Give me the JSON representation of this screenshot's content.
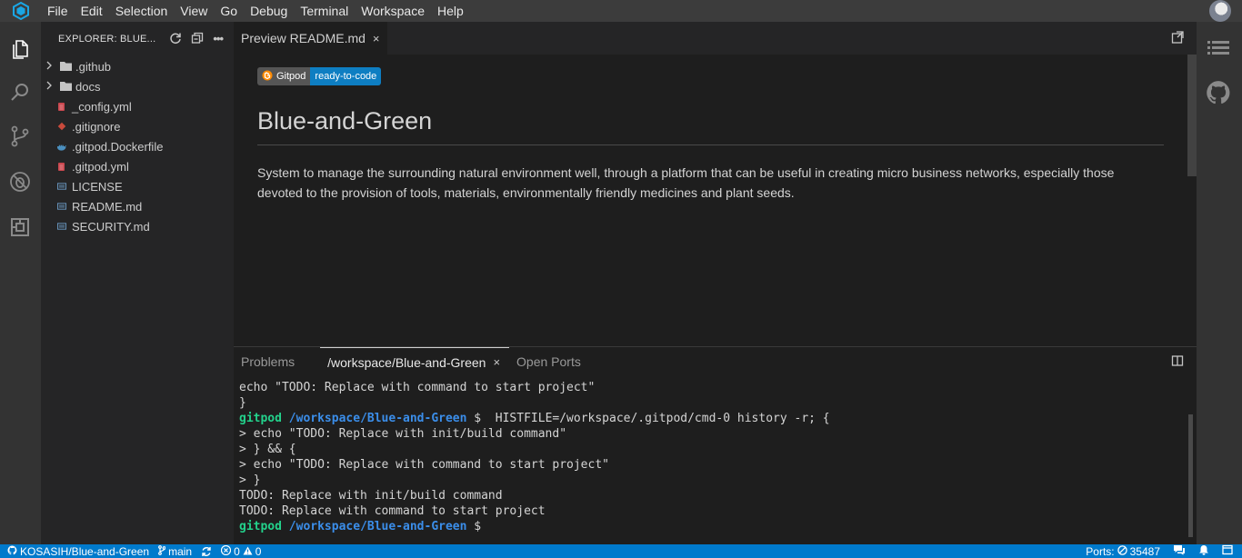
{
  "menu": {
    "items": [
      "File",
      "Edit",
      "Selection",
      "View",
      "Go",
      "Debug",
      "Terminal",
      "Workspace",
      "Help"
    ]
  },
  "activity_bar": {
    "icons": [
      "files-icon",
      "search-icon",
      "source-control-icon",
      "debug-icon",
      "extensions-icon"
    ]
  },
  "explorer": {
    "title": "EXPLORER: BLUE...",
    "items": [
      {
        "label": ".github",
        "type": "folder"
      },
      {
        "label": "docs",
        "type": "folder"
      },
      {
        "label": "_config.yml",
        "type": "yaml"
      },
      {
        "label": ".gitignore",
        "type": "git"
      },
      {
        "label": ".gitpod.Dockerfile",
        "type": "docker"
      },
      {
        "label": ".gitpod.yml",
        "type": "yaml"
      },
      {
        "label": "LICENSE",
        "type": "text"
      },
      {
        "label": "README.md",
        "type": "markdown"
      },
      {
        "label": "SECURITY.md",
        "type": "markdown"
      }
    ]
  },
  "editor": {
    "tab_label": "Preview README.md",
    "tab_close": "×",
    "badge_left": "Gitpod",
    "badge_right": "ready-to-code",
    "heading": "Blue-and-Green",
    "paragraph": "System to manage the surrounding natural environment well, through a platform that can be useful in creating micro business networks, especially those devoted to the provision of tools, materials, environmentally friendly medicines and plant seeds."
  },
  "panel": {
    "tabs": [
      "Problems",
      "/workspace/Blue-and-Green",
      "Open Ports"
    ],
    "active_tab_index": 1,
    "tab_close": "×",
    "terminal": {
      "line1": "echo \"TODO: Replace with command to start project\"",
      "line2": "}",
      "prompt_user": "gitpod",
      "prompt_path": "/workspace/Blue-and-Green",
      "prompt_symbol": "$",
      "line3_cmd": "  HISTFILE=/workspace/.gitpod/cmd-0 history -r; {",
      "line4": "> echo \"TODO: Replace with init/build command\"",
      "line5": "> } && {",
      "line6": "> echo \"TODO: Replace with command to start project\"",
      "line7": "> }",
      "line8": "TODO: Replace with init/build command",
      "line9": "TODO: Replace with command to start project"
    }
  },
  "status_bar": {
    "repo": "KOSASIH/Blue-and-Green",
    "branch": "main",
    "errors": "0",
    "warnings": "0",
    "ports": "Ports: ",
    "port_number": "35487"
  },
  "colors": {
    "accent": "#007acc",
    "prompt_user": "#23d18b",
    "prompt_path": "#3b8eea"
  }
}
